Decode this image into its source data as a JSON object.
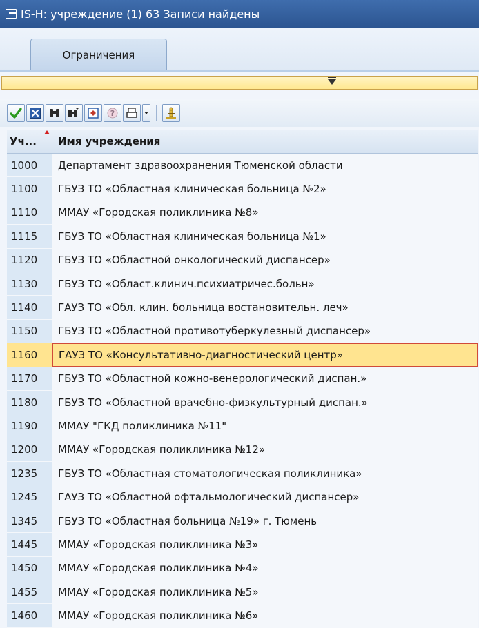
{
  "window": {
    "title": "IS-H: учреждение (1)   63 Записи найдены"
  },
  "tabs": [
    {
      "label": "Ограничения"
    }
  ],
  "toolbar": {
    "buttons": [
      {
        "icon": "check-icon"
      },
      {
        "icon": "cancel-icon"
      },
      {
        "icon": "find-icon"
      },
      {
        "icon": "find-next-icon"
      },
      {
        "icon": "multiple-selection-icon"
      },
      {
        "icon": "help-icon"
      },
      {
        "icon": "print-icon"
      },
      {
        "icon": "print-dropdown-icon"
      },
      {
        "icon": "personalize-icon"
      }
    ]
  },
  "table": {
    "columns": [
      "Уч...",
      "Имя учреждения"
    ],
    "selected_row_index": 8,
    "rows": [
      {
        "code": "1000",
        "name": "Департамент здравоохранения Тюменской области"
      },
      {
        "code": "1100",
        "name": "ГБУЗ ТО «Областная клиническая больница №2»"
      },
      {
        "code": "1110",
        "name": "ММАУ «Городская поликлиника №8»"
      },
      {
        "code": "1115",
        "name": "ГБУЗ ТО «Областная клиническая больница №1»"
      },
      {
        "code": "1120",
        "name": "ГБУЗ ТО «Областной онкологический диспансер»"
      },
      {
        "code": "1130",
        "name": "ГБУЗ ТО «Област.клинич.психиатричес.больн»"
      },
      {
        "code": "1140",
        "name": "ГАУЗ ТО «Обл. клин. больница востановительн. леч»"
      },
      {
        "code": "1150",
        "name": "ГБУЗ ТО «Областной противотуберкулезный диспансер»"
      },
      {
        "code": "1160",
        "name": "ГАУЗ ТО «Консультативно-диагностический центр»"
      },
      {
        "code": "1170",
        "name": "ГБУЗ ТО «Областной кожно-венерологический диспан.»"
      },
      {
        "code": "1180",
        "name": "ГБУЗ ТО «Областной врачебно-физкультурный диспан.»"
      },
      {
        "code": "1190",
        "name": "ММАУ \"ГКД поликлиника №11\""
      },
      {
        "code": "1200",
        "name": "ММАУ «Городская поликлиника №12»"
      },
      {
        "code": "1235",
        "name": "ГБУЗ ТО «Областная стоматологическая поликлиника»"
      },
      {
        "code": "1245",
        "name": "ГАУЗ ТО «Областной офтальмологический диспансер»"
      },
      {
        "code": "1345",
        "name": "ГБУЗ ТО «Областная больница №19» г. Тюмень"
      },
      {
        "code": "1445",
        "name": "ММАУ «Городская поликлиника №3»"
      },
      {
        "code": "1450",
        "name": "ММАУ «Городская поликлиника №4»"
      },
      {
        "code": "1455",
        "name": "ММАУ «Городская поликлиника №5»"
      },
      {
        "code": "1460",
        "name": "ММАУ «Городская поликлиника №6»"
      }
    ]
  }
}
